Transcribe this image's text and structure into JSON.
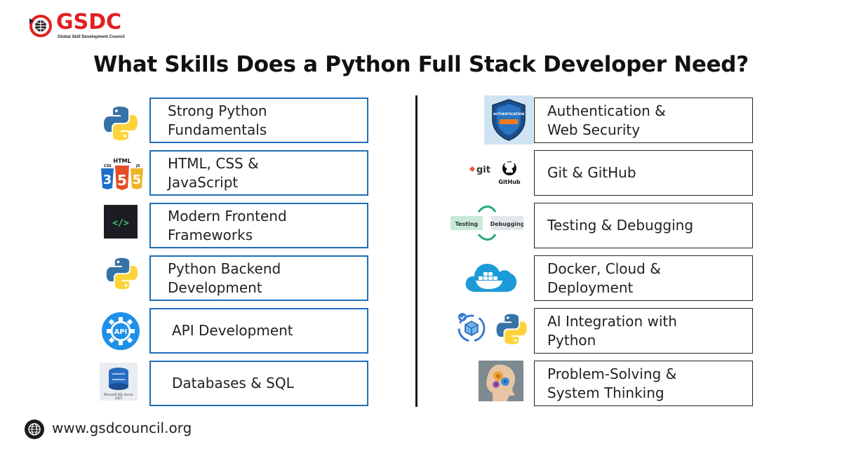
{
  "brand": {
    "name": "GSDC",
    "tagline": "Global Skill Development Council",
    "red": "#e02020"
  },
  "title": "What Skills Does a Python Full Stack Developer Need?",
  "left_skills": [
    {
      "label": "Strong Python\nFundamentals",
      "icon": "python-logo-icon"
    },
    {
      "label": " HTML, CSS &\nJavaScript",
      "icon": "html-css-js-icon"
    },
    {
      "label": "Modern Frontend\nFrameworks",
      "icon": "code-terminal-icon"
    },
    {
      "label": "Python Backend\nDevelopment",
      "icon": "python-logo-icon"
    },
    {
      "label": "API Development",
      "icon": "api-gear-icon"
    },
    {
      "label": "Databases & SQL",
      "icon": "sql-server-icon"
    }
  ],
  "right_skills": [
    {
      "label": "Authentication &\nWeb Security",
      "icon": "security-shield-icon"
    },
    {
      "label": "Git & GitHub",
      "icon": "git-github-icon"
    },
    {
      "label": "Testing & Debugging",
      "icon": "testing-debugging-cycle-icon"
    },
    {
      "label": "Docker, Cloud &\nDeployment",
      "icon": "docker-cloud-icon"
    },
    {
      "label": "AI Integration with\nPython",
      "icon": "ai-python-icon"
    },
    {
      "label": "Problem-Solving &\nSystem Thinking",
      "icon": "brain-gears-icon"
    }
  ],
  "icon_text": {
    "html": "HTML",
    "css": "CSS",
    "js": "JS",
    "five": "5",
    "code": "</>",
    "api": "API",
    "sql": "Microsoft SQL Server",
    "sql_year": "2025",
    "auth": "AUTHENTICATION",
    "git": "git",
    "github": "GitHub",
    "testing": "Testing",
    "debugging": "Debugging"
  },
  "colors": {
    "box_border_left": "#1e6fb7",
    "box_border_right": "#222222",
    "python_blue": "#3572a5",
    "python_yellow": "#ffd43b",
    "docker_blue": "#1d9bd8"
  },
  "footer": {
    "url": "www.gsdcouncil.org",
    "icon": "globe-icon"
  }
}
